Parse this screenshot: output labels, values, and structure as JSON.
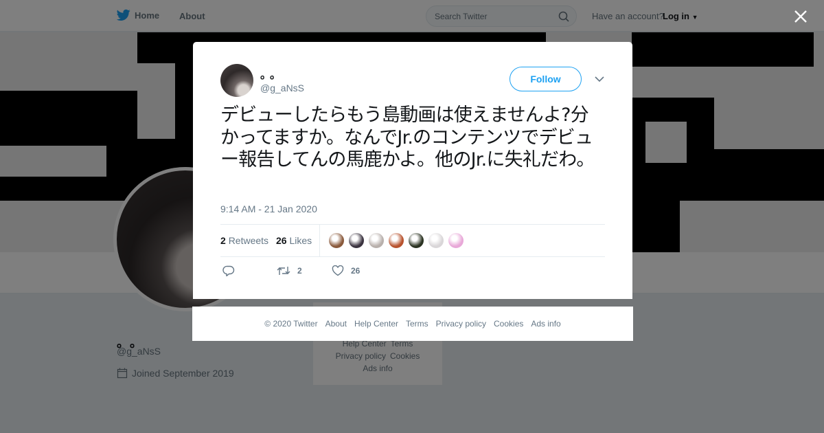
{
  "topbar": {
    "home": "Home",
    "about": "About",
    "search_placeholder": "Search Twitter",
    "account_question": "Have an account?",
    "login": "Log in"
  },
  "profile": {
    "name": "。。",
    "handle": "@g_aNsS",
    "joined": "Joined September 2019"
  },
  "side_footer": [
    "Help Center",
    "Terms",
    "Privacy policy",
    "Cookies",
    "Ads info"
  ],
  "tweet": {
    "author_name": "。。",
    "author_handle": "@g_aNsS",
    "follow_label": "Follow",
    "text": "デビューしたらもう島動画は使えませんよ?分かってますか。なんでJr.のコンテンツでデビュー報告してんの馬鹿かよ。他のJr.に失礼だわ。",
    "timestamp": "9:14 AM - 21 Jan 2020",
    "retweets_count": "2",
    "retweets_label": "Retweets",
    "likes_count": "26",
    "likes_label": "Likes",
    "action_retweets": "2",
    "action_likes": "26",
    "liker_colors": [
      "#8a5a3c",
      "#3b3440",
      "#b8b0ac",
      "#b8532e",
      "#2b3322",
      "#d9d6d8",
      "#e8a8d8"
    ]
  },
  "footer": {
    "copyright": "© 2020 Twitter",
    "links": [
      "About",
      "Help Center",
      "Terms",
      "Privacy policy",
      "Cookies",
      "Ads info"
    ]
  },
  "colors": {
    "twitter_blue": "#1da1f2",
    "muted_text": "#657786"
  }
}
